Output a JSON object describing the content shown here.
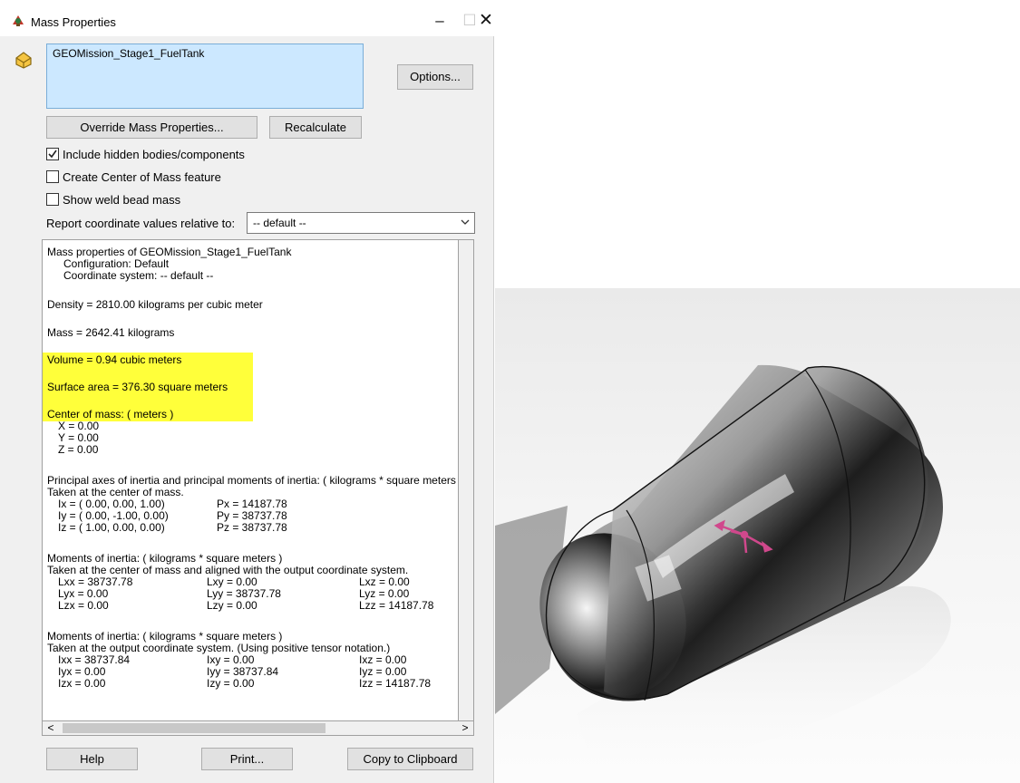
{
  "window": {
    "title": "Mass Properties",
    "minimize": "–",
    "maximize": "☐",
    "close": "✕"
  },
  "selection": {
    "item": "GEOMission_Stage1_FuelTank"
  },
  "buttons": {
    "options": "Options...",
    "override": "Override Mass Properties...",
    "recalculate": "Recalculate",
    "help": "Help",
    "print": "Print...",
    "copy": "Copy to Clipboard"
  },
  "checkboxes": [
    {
      "label": "Include hidden bodies/components",
      "checked": true
    },
    {
      "label": "Create Center of Mass feature",
      "checked": false
    },
    {
      "label": "Show weld bead mass",
      "checked": false
    }
  ],
  "report": {
    "label": "Report coordinate values relative to:",
    "selected": "-- default --"
  },
  "results": {
    "header": "Mass properties of GEOMission_Stage1_FuelTank",
    "config": "Configuration: Default",
    "coordsys": "Coordinate system: -- default --",
    "density": "Density = 2810.00 kilograms per cubic meter",
    "mass": "Mass = 2642.41 kilograms",
    "volume": "Volume = 0.94 cubic meters",
    "surface": "Surface area = 376.30 square meters",
    "com_header": "Center of mass: ( meters )",
    "com_x": "X = 0.00",
    "com_y": "Y = 0.00",
    "com_z": "Z = 0.00",
    "principal_header": "Principal axes of inertia and principal moments of inertia: ( kilograms * square meters )",
    "principal_sub": "Taken at the center of mass.",
    "ix": "Ix = ( 0.00,  0.00,  1.00)",
    "iy": "Iy = ( 0.00, -1.00,  0.00)",
    "iz": "Iz = ( 1.00,  0.00,  0.00)",
    "px": "Px = 14187.78",
    "py": "Py = 38737.78",
    "pz": "Pz = 38737.78",
    "moments1_header": "Moments of inertia: ( kilograms * square meters )",
    "moments1_sub": "Taken at the center of mass and aligned with the output coordinate system.",
    "m1": [
      [
        "Lxx = 38737.78",
        "Lxy = 0.00",
        "Lxz = 0.00"
      ],
      [
        "Lyx = 0.00",
        "Lyy = 38737.78",
        "Lyz = 0.00"
      ],
      [
        "Lzx = 0.00",
        "Lzy = 0.00",
        "Lzz = 14187.78"
      ]
    ],
    "moments2_header": "Moments of inertia: ( kilograms * square meters )",
    "moments2_sub": "Taken at the output coordinate system. (Using positive tensor notation.)",
    "m2": [
      [
        "Ixx = 38737.84",
        "Ixy = 0.00",
        "Ixz = 0.00"
      ],
      [
        "Iyx = 0.00",
        "Iyy = 38737.84",
        "Iyz = 0.00"
      ],
      [
        "Izx = 0.00",
        "Izy = 0.00",
        "Izz = 14187.78"
      ]
    ]
  },
  "scroll": {
    "left": "<",
    "right": ">"
  },
  "colors": {
    "highlight": "#ffff3a",
    "selection": "#cce8ff",
    "triad": "#d0488c"
  },
  "viewport": {
    "model_icon": "capsule-fuel-tank"
  }
}
